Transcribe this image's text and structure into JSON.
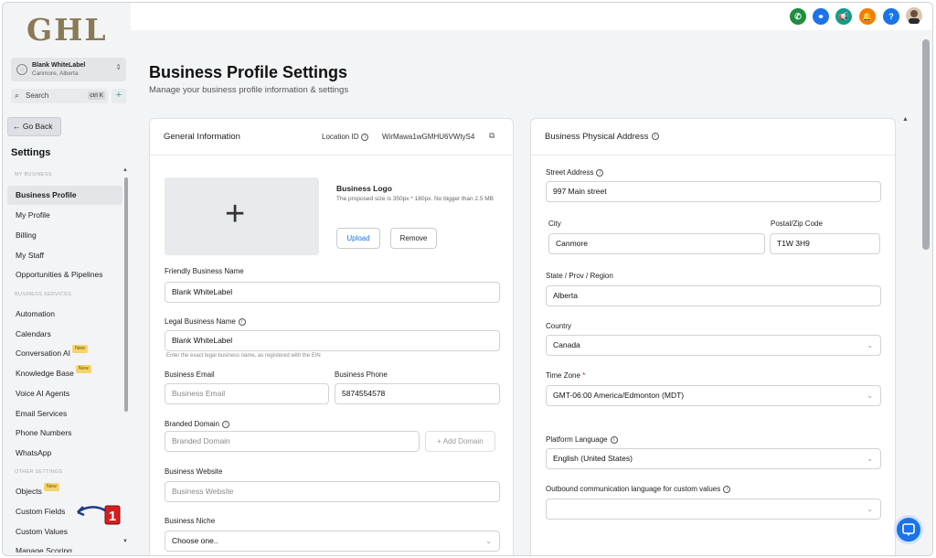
{
  "brand": {
    "logo_text": "GHL"
  },
  "location": {
    "name": "Blank WhiteLabel",
    "place": "Canmore, Alberta"
  },
  "search": {
    "label": "Search",
    "shortcut": "ctrl K"
  },
  "back_label": "← Go Back",
  "settings_title": "Settings",
  "nav": {
    "sec_business": "MY BUSINESS",
    "sec_services": "BUSINESS SERVICES",
    "sec_other": "OTHER SETTINGS",
    "items": [
      "Business Profile",
      "My Profile",
      "Billing",
      "My Staff",
      "Opportunities & Pipelines",
      "Automation",
      "Calendars",
      "Conversation AI",
      "Knowledge Base",
      "Voice AI Agents",
      "Email Services",
      "Phone Numbers",
      "WhatsApp",
      "Objects",
      "Custom Fields",
      "Custom Values",
      "Manage Scoring"
    ],
    "new_badge": "New",
    "annotation_number": "1"
  },
  "page": {
    "title": "Business Profile Settings",
    "subtitle": "Manage your business profile information & settings"
  },
  "general": {
    "title": "General Information",
    "location_id_label": "Location ID",
    "location_id": "WirMawa1wGMHU6VWtyS4",
    "logo_title": "Business Logo",
    "logo_help": "The proposed size is 350px * 180px. No bigger than 2.5 MB",
    "upload": "Upload",
    "remove": "Remove",
    "friendly_label": "Friendly Business Name",
    "friendly_value": "Blank WhiteLabel",
    "legal_label": "Legal Business Name",
    "legal_value": "Blank WhiteLabel",
    "legal_help": "Enter the exact legal business name, as registered with the EIN",
    "email_label": "Business Email",
    "email_placeholder": "Business Email",
    "phone_label": "Business Phone",
    "phone_value": "5874554578",
    "domain_label": "Branded Domain",
    "domain_placeholder": "Branded Domain",
    "add_domain": "+ Add Domain",
    "website_label": "Business Website",
    "website_placeholder": "Business Website",
    "niche_label": "Business Niche",
    "niche_placeholder": "Choose one.."
  },
  "address": {
    "title": "Business Physical Address",
    "street_label": "Street Address",
    "street_value": "997 Main street",
    "city_label": "City",
    "city_value": "Canmore",
    "postal_label": "Postal/Zip Code",
    "postal_value": "T1W 3H9",
    "state_label": "State / Prov / Region",
    "state_value": "Alberta",
    "country_label": "Country",
    "country_value": "Canada",
    "tz_label": "Time Zone",
    "tz_required": "*",
    "tz_value": "GMT-06:00 America/Edmonton (MDT)",
    "lang_label": "Platform Language",
    "lang_value": "English (United States)",
    "outbound_label": "Outbound communication language for custom values",
    "outbound_value": ""
  },
  "colors": {
    "accent": "#1a73e8",
    "brand_gold": "#8a7a55",
    "new_badge": "#f4d46b",
    "annotation_red": "#d61f1f"
  }
}
